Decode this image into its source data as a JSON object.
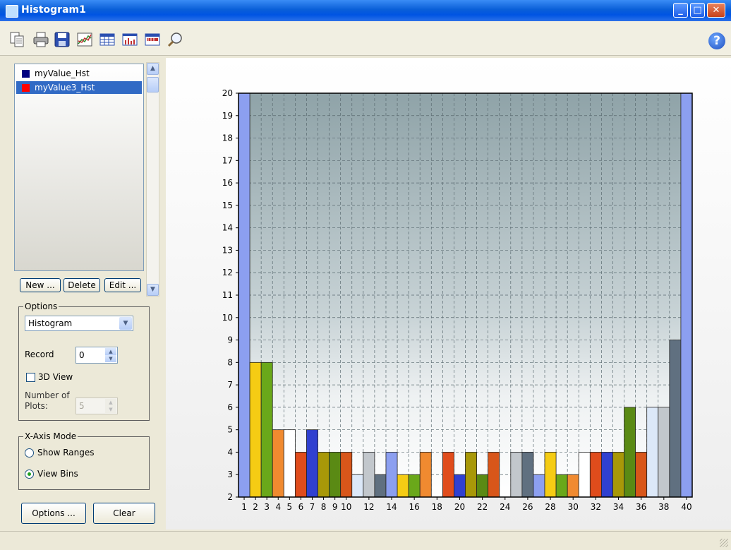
{
  "window": {
    "title": "Histogram1",
    "minimize_glyph": "_",
    "maximize_glyph": "□",
    "close_glyph": "✕"
  },
  "toolbar": {
    "icons": [
      "copy-icon",
      "print-icon",
      "save-icon",
      "chart-icon",
      "table-icon",
      "histogram-icon",
      "grid-icon",
      "zoom-icon"
    ],
    "help_glyph": "?"
  },
  "datasets": {
    "items": [
      {
        "label": "myValue_Hst",
        "color": "#000080",
        "selected": false
      },
      {
        "label": "myValue3_Hst",
        "color": "#ff0000",
        "selected": true
      }
    ],
    "new_label": "New ...",
    "delete_label": "Delete",
    "edit_label": "Edit ..."
  },
  "options": {
    "title": "Options",
    "mode_value": "Histogram",
    "record_label": "Record",
    "record_value": "0",
    "view3d_label": "3D View",
    "view3d_checked": false,
    "plots_label_line1": "Number of",
    "plots_label_line2": "Plots:",
    "plots_value": "5"
  },
  "xaxis_mode": {
    "title": "X-Axis Mode",
    "show_ranges_label": "Show Ranges",
    "view_bins_label": "View Bins",
    "selected": "View Bins"
  },
  "buttons": {
    "options_label": "Options ...",
    "clear_label": "Clear"
  },
  "chart_data": {
    "type": "bar",
    "categories": [
      1,
      2,
      3,
      4,
      5,
      6,
      7,
      8,
      9,
      10,
      11,
      12,
      13,
      14,
      15,
      16,
      17,
      18,
      19,
      20,
      21,
      22,
      23,
      24,
      25,
      26,
      27,
      28,
      29,
      30,
      31,
      32,
      33,
      34,
      35,
      36,
      37,
      38,
      39,
      40
    ],
    "values": [
      20,
      8,
      8,
      5,
      5,
      4,
      5,
      4,
      4,
      4,
      3,
      4,
      3,
      4,
      3,
      3,
      4,
      2,
      4,
      3,
      4,
      3,
      4,
      2,
      4,
      4,
      3,
      4,
      3,
      3,
      4,
      4,
      4,
      4,
      6,
      4,
      6,
      6,
      9,
      20
    ],
    "colors": [
      "#8c9ff0",
      "#f5cc14",
      "#6aa81a",
      "#f08a30",
      "#ffffff",
      "#e04c1c",
      "#3040d0",
      "#a89808",
      "#5a8a14",
      "#d8561a",
      "#dce8f8",
      "#c2c7cc",
      "#607080",
      "#8c9ff0",
      "#f5cc14",
      "#6aa81a",
      "#f08a30",
      "#ffffff",
      "#e04c1c",
      "#3040d0",
      "#a89808",
      "#5a8a14",
      "#d8561a",
      "#dce8f8",
      "#c2c7cc",
      "#607080",
      "#8c9ff0",
      "#f5cc14",
      "#6aa81a",
      "#f08a30",
      "#ffffff",
      "#e04c1c",
      "#3040d0",
      "#a89808",
      "#5a8a14",
      "#d8561a",
      "#dce8f8",
      "#c2c7cc",
      "#607080",
      "#8c9ff0"
    ],
    "y_ticks": [
      2,
      3,
      4,
      5,
      6,
      7,
      8,
      9,
      10,
      11,
      12,
      13,
      14,
      15,
      16,
      17,
      18,
      19,
      20
    ],
    "x_tick_labels": [
      "1",
      "2",
      "3",
      "4",
      "5",
      "6",
      "7",
      "8",
      "9",
      "10",
      "12",
      "14",
      "16",
      "18",
      "20",
      "22",
      "24",
      "26",
      "28",
      "30",
      "32",
      "34",
      "36",
      "38",
      "40"
    ],
    "x_tick_values": [
      1,
      2,
      3,
      4,
      5,
      6,
      7,
      8,
      9,
      10,
      12,
      14,
      16,
      18,
      20,
      22,
      24,
      26,
      28,
      30,
      32,
      34,
      36,
      38,
      40
    ],
    "ylim": [
      2,
      20
    ],
    "grid": true,
    "title": "",
    "xlabel": "",
    "ylabel": ""
  }
}
